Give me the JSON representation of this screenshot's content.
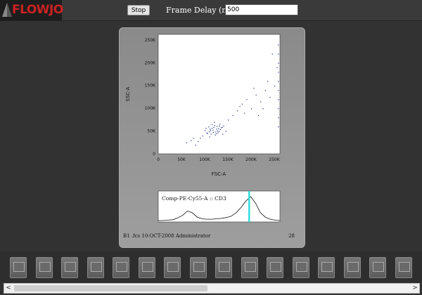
{
  "app": {
    "logo_text": "FLOWJO"
  },
  "toolbar": {
    "stop_label": "Stop",
    "frame_delay_label": "Frame Delay (ms):",
    "frame_delay_value": "500"
  },
  "chart_data": [
    {
      "type": "scatter",
      "xlabel": "FSC-A",
      "ylabel": "SSC-A",
      "xlim": [
        0,
        262144
      ],
      "ylim": [
        0,
        262144
      ],
      "x_ticks": [
        "0",
        "50K",
        "100K",
        "150K",
        "200K",
        "250K"
      ],
      "y_ticks": [
        "0",
        "50K",
        "100K",
        "150K",
        "200K",
        "250K"
      ],
      "series": [
        {
          "color": "#1a2a8a",
          "points": [
            [
              105000,
              45000
            ],
            [
              112000,
              52000
            ],
            [
              118000,
              48000
            ],
            [
              125000,
              55000
            ],
            [
              130000,
              50000
            ],
            [
              108000,
              60000
            ],
            [
              122000,
              42000
            ],
            [
              135000,
              58000
            ],
            [
              115000,
              65000
            ],
            [
              128000,
              47000
            ],
            [
              100000,
              52000
            ],
            [
              140000,
              62000
            ],
            [
              95000,
              40000
            ],
            [
              145000,
              50000
            ],
            [
              120000,
              70000
            ],
            [
              110000,
              38000
            ],
            [
              132000,
              66000
            ],
            [
              138000,
              44000
            ],
            [
              102000,
              57000
            ],
            [
              126000,
              61000
            ],
            [
              117000,
              53000
            ],
            [
              123000,
              49000
            ],
            [
              113000,
              44000
            ],
            [
              129000,
              56000
            ],
            [
              119000,
              59000
            ],
            [
              90000,
              35000
            ],
            [
              150000,
              75000
            ],
            [
              160000,
              85000
            ],
            [
              170000,
              95000
            ],
            [
              180000,
              110000
            ],
            [
              190000,
              120000
            ],
            [
              200000,
              100000
            ],
            [
              210000,
              130000
            ],
            [
              220000,
              115000
            ],
            [
              230000,
              140000
            ],
            [
              240000,
              125000
            ],
            [
              250000,
              150000
            ],
            [
              205000,
              145000
            ],
            [
              185000,
              90000
            ],
            [
              175000,
              105000
            ],
            [
              60000,
              25000
            ],
            [
              70000,
              30000
            ],
            [
              80000,
              20000
            ],
            [
              75000,
              35000
            ],
            [
              85000,
              28000
            ],
            [
              255000,
              190000
            ],
            [
              245000,
              220000
            ],
            [
              235000,
              160000
            ],
            [
              225000,
              100000
            ],
            [
              215000,
              85000
            ],
            [
              258000,
              80000
            ],
            [
              258000,
              120000
            ],
            [
              258000,
              160000
            ],
            [
              258000,
              200000
            ],
            [
              258000,
              240000
            ],
            [
              258000,
              60000
            ],
            [
              258000,
              100000
            ],
            [
              258000,
              140000
            ],
            [
              258000,
              180000
            ],
            [
              258000,
              220000
            ],
            [
              115000,
              57000
            ],
            [
              121000,
              63000
            ],
            [
              127000,
              51000
            ],
            [
              109000,
              49000
            ],
            [
              133000,
              54000
            ],
            [
              104000,
              47000
            ],
            [
              137000,
              59000
            ],
            [
              111000,
              55000
            ],
            [
              124000,
              45000
            ],
            [
              131000,
              62000
            ]
          ]
        }
      ]
    },
    {
      "type": "line",
      "title": "Comp-PE-Cy55-A :: CD3",
      "x": [
        0,
        10,
        20,
        30,
        40,
        50,
        60,
        70,
        80,
        90,
        100,
        110,
        120,
        130,
        140,
        150,
        160,
        170,
        180,
        190,
        200,
        210,
        220,
        230,
        240,
        250
      ],
      "y": [
        0,
        0,
        1,
        2,
        6,
        12,
        22,
        18,
        8,
        4,
        3,
        3,
        4,
        5,
        7,
        10,
        18,
        30,
        45,
        55,
        40,
        18,
        8,
        3,
        1,
        0
      ],
      "gate_line_color": "#33dddd"
    }
  ],
  "panel": {
    "footer_left": "B1 .fcs 10-OCT-2008 Administrator",
    "footer_right": "28"
  },
  "thumbnails": {
    "count": 16
  },
  "scrollbar": {
    "left_arrow": "<",
    "right_arrow": ">",
    "position": 0.47
  }
}
